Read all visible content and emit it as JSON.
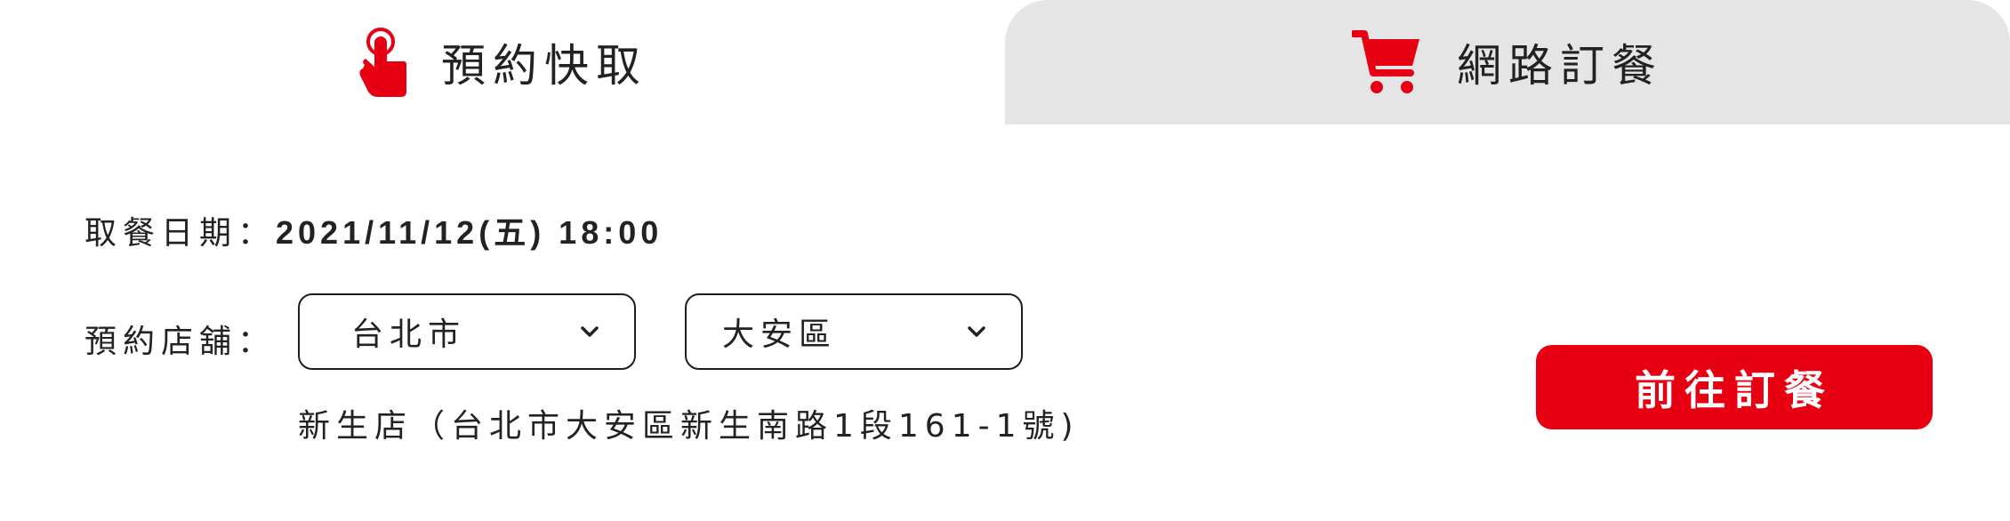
{
  "tabs": [
    {
      "label": "預約快取",
      "icon": "tap-finger-icon",
      "active": true
    },
    {
      "label": "網路訂餐",
      "icon": "shopping-cart-icon",
      "active": false
    }
  ],
  "pickup": {
    "date_label": "取餐日期：",
    "date_value": "2021/11/12(五) 18:00",
    "store_label": "預約店舖：",
    "city_selected": "台北市",
    "district_selected": "大安區",
    "store_address": "新生店（台北市大安區新生南路1段161-1號)"
  },
  "cta": {
    "label": "前往訂餐"
  },
  "colors": {
    "brand_red": "#e60012",
    "tab_inactive_bg": "#e5e5e5",
    "text": "#222222"
  }
}
